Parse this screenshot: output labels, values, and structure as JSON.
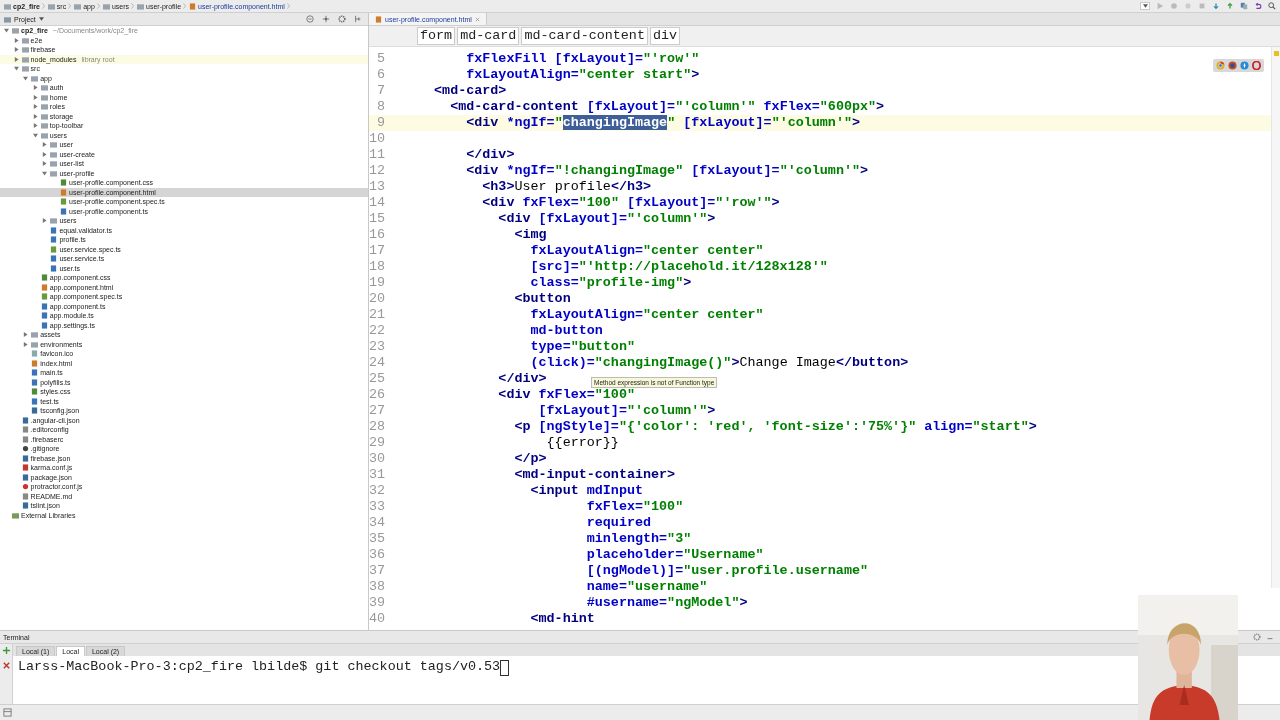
{
  "breadcrumbs": [
    {
      "label": "cp2_fire",
      "kind": "folder"
    },
    {
      "label": "src",
      "kind": "folder"
    },
    {
      "label": "app",
      "kind": "folder"
    },
    {
      "label": "users",
      "kind": "folder"
    },
    {
      "label": "user-profile",
      "kind": "folder"
    },
    {
      "label": "user-profile.component.html",
      "kind": "html"
    }
  ],
  "project_panel": {
    "title": "Project",
    "tree": [
      {
        "label": "cp2_fire",
        "path": "~/Documents/work/cp2_fire",
        "kind": "folder",
        "expanded": true,
        "selected": false,
        "children": [
          {
            "label": "e2e",
            "kind": "folder",
            "expanded": false,
            "selected": false
          },
          {
            "label": "firebase",
            "kind": "folder",
            "expanded": false,
            "selected": false
          },
          {
            "label": "node_modules",
            "hint": "library root",
            "kind": "folder",
            "expanded": false,
            "selected": false
          },
          {
            "label": "src",
            "kind": "folder",
            "expanded": true,
            "selected": false,
            "children": [
              {
                "label": "app",
                "kind": "folder",
                "expanded": true,
                "selected": false,
                "children": [
                  {
                    "label": "auth",
                    "kind": "folder",
                    "expanded": false,
                    "selected": false
                  },
                  {
                    "label": "home",
                    "kind": "folder",
                    "expanded": false,
                    "selected": false
                  },
                  {
                    "label": "roles",
                    "kind": "folder",
                    "expanded": false,
                    "selected": false
                  },
                  {
                    "label": "storage",
                    "kind": "folder",
                    "expanded": false,
                    "selected": false
                  },
                  {
                    "label": "top-toolbar",
                    "kind": "folder",
                    "expanded": false,
                    "selected": false
                  },
                  {
                    "label": "users",
                    "kind": "folder",
                    "expanded": true,
                    "selected": false,
                    "children": [
                      {
                        "label": "user",
                        "kind": "folder",
                        "expanded": false,
                        "selected": false
                      },
                      {
                        "label": "user-create",
                        "kind": "folder",
                        "expanded": false,
                        "selected": false
                      },
                      {
                        "label": "user-list",
                        "kind": "folder",
                        "expanded": false,
                        "selected": false
                      },
                      {
                        "label": "user-profile",
                        "kind": "folder",
                        "expanded": true,
                        "selected": false,
                        "children": [
                          {
                            "label": "user-profile.component.css",
                            "kind": "css",
                            "selected": false
                          },
                          {
                            "label": "user-profile.component.html",
                            "kind": "html",
                            "selected": true
                          },
                          {
                            "label": "user-profile.component.spec.ts",
                            "kind": "spec",
                            "selected": false
                          },
                          {
                            "label": "user-profile.component.ts",
                            "kind": "ts",
                            "selected": false
                          }
                        ]
                      },
                      {
                        "label": "users",
                        "kind": "folder",
                        "expanded": false,
                        "selected": false
                      },
                      {
                        "label": "equal.validator.ts",
                        "kind": "ts",
                        "selected": false
                      },
                      {
                        "label": "profile.ts",
                        "kind": "ts",
                        "selected": false
                      },
                      {
                        "label": "user.service.spec.ts",
                        "kind": "spec",
                        "selected": false
                      },
                      {
                        "label": "user.service.ts",
                        "kind": "ts",
                        "selected": false
                      },
                      {
                        "label": "user.ts",
                        "kind": "ts",
                        "selected": false
                      }
                    ]
                  },
                  {
                    "label": "app.component.css",
                    "kind": "css",
                    "selected": false
                  },
                  {
                    "label": "app.component.html",
                    "kind": "html",
                    "selected": false
                  },
                  {
                    "label": "app.component.spec.ts",
                    "kind": "spec",
                    "selected": false
                  },
                  {
                    "label": "app.component.ts",
                    "kind": "ts",
                    "selected": false
                  },
                  {
                    "label": "app.module.ts",
                    "kind": "ts",
                    "selected": false
                  },
                  {
                    "label": "app.settings.ts",
                    "kind": "ts",
                    "selected": false
                  }
                ]
              },
              {
                "label": "assets",
                "kind": "folder",
                "expanded": false,
                "selected": false
              },
              {
                "label": "environments",
                "kind": "folder",
                "expanded": false,
                "selected": false
              },
              {
                "label": "favicon.ico",
                "selected": false
              },
              {
                "label": "index.html",
                "kind": "html",
                "selected": false
              },
              {
                "label": "main.ts",
                "kind": "ts",
                "selected": false
              },
              {
                "label": "polyfills.ts",
                "kind": "ts",
                "selected": false
              },
              {
                "label": "styles.css",
                "kind": "css",
                "selected": false
              },
              {
                "label": "test.ts",
                "kind": "ts",
                "selected": false
              },
              {
                "label": "tsconfig.json",
                "kind": "json",
                "selected": false
              }
            ]
          },
          {
            "label": ".angular-cli.json",
            "kind": "json",
            "selected": false
          },
          {
            "label": ".editorconfig",
            "kind": "text",
            "selected": false
          },
          {
            "label": ".firebaserc",
            "kind": "text",
            "selected": false
          },
          {
            "label": ".gitignore",
            "kind": "git",
            "selected": false
          },
          {
            "label": "firebase.json",
            "kind": "json",
            "selected": false
          },
          {
            "label": "karma.conf.js",
            "kind": "karma",
            "selected": false
          },
          {
            "label": "package.json",
            "kind": "json",
            "selected": false
          },
          {
            "label": "protractor.conf.js",
            "kind": "protractor",
            "selected": false
          },
          {
            "label": "README.md",
            "kind": "text",
            "selected": false
          },
          {
            "label": "tslint.json",
            "kind": "json",
            "selected": false
          }
        ]
      },
      {
        "label": "External Libraries",
        "kind": "libraries",
        "selected": false
      }
    ]
  },
  "editor": {
    "tab": {
      "label": "user-profile.component.html",
      "selected": true
    },
    "breadcrumbs": [
      "form",
      "md-card",
      "md-card-content",
      "div"
    ],
    "lines": [
      {
        "num": "5",
        "current": false,
        "segments": [
          {
            "text": "      fxFlexFill [fxLayout]=\"'row'\"",
            "selected": false
          }
        ]
      },
      {
        "num": "6",
        "current": false,
        "segments": [
          {
            "text": "      fxLayoutAlign=\"center start\">",
            "selected": false
          }
        ]
      },
      {
        "num": "7",
        "current": false,
        "segments": [
          {
            "text": "  <md-card>",
            "selected": false
          }
        ]
      },
      {
        "num": "8",
        "current": false,
        "segments": [
          {
            "text": "    <md-card-content [fxLayout]=\"'column'\" fxFlex=\"600px\">",
            "selected": false
          }
        ]
      },
      {
        "num": "9",
        "current": true,
        "segments": [
          {
            "text": "      <div *ngIf=\"",
            "selected": false
          },
          {
            "text": "changingImage",
            "selected": true
          },
          {
            "text": "\" [fxLayout]=\"'column'\">",
            "selected": false
          }
        ]
      },
      {
        "num": "10",
        "current": false
      },
      {
        "num": "11",
        "current": false,
        "segments": [
          {
            "text": "      </div>",
            "selected": false
          }
        ]
      },
      {
        "num": "12",
        "current": false,
        "segments": [
          {
            "text": "      <div *ngIf=\"!changingImage\" [fxLayout]=\"'column'\">",
            "selected": false
          }
        ]
      },
      {
        "num": "13",
        "current": false,
        "segments": [
          {
            "text": "        <h3>User profile</h3>",
            "selected": false
          }
        ]
      },
      {
        "num": "14",
        "current": false,
        "segments": [
          {
            "text": "        <div fxFlex=\"100\" [fxLayout]=\"'row'\">",
            "selected": false
          }
        ]
      },
      {
        "num": "15",
        "current": false,
        "segments": [
          {
            "text": "          <div [fxLayout]=\"'column'\">",
            "selected": false
          }
        ]
      },
      {
        "num": "16",
        "current": false,
        "segments": [
          {
            "text": "            <img",
            "selected": false
          }
        ]
      },
      {
        "num": "17",
        "current": false,
        "segments": [
          {
            "text": "              fxLayoutAlign=\"center center\"",
            "selected": false
          }
        ]
      },
      {
        "num": "18",
        "current": false,
        "segments": [
          {
            "text": "              [src]=\"'http://placehold.it/128x128'\"",
            "selected": false
          }
        ]
      },
      {
        "num": "19",
        "current": false,
        "segments": [
          {
            "text": "              class=\"profile-img\">",
            "selected": false
          }
        ]
      },
      {
        "num": "20",
        "current": false,
        "segments": [
          {
            "text": "            <button",
            "selected": false
          }
        ]
      },
      {
        "num": "21",
        "current": false,
        "segments": [
          {
            "text": "              fxLayoutAlign=\"center center\"",
            "selected": false
          }
        ]
      },
      {
        "num": "22",
        "current": false,
        "segments": [
          {
            "text": "              md-button",
            "selected": false
          }
        ]
      },
      {
        "num": "23",
        "current": false,
        "segments": [
          {
            "text": "              type=\"button\"",
            "selected": false
          }
        ]
      },
      {
        "num": "24",
        "current": false,
        "segments": [
          {
            "text": "              (click)=\"changingImage()\">Change Image</button>",
            "selected": false
          }
        ],
        "tooltip": "Method expression is not of Function type"
      },
      {
        "num": "25",
        "current": false,
        "segments": [
          {
            "text": "          </div>",
            "selected": false
          }
        ]
      },
      {
        "num": "26",
        "current": false,
        "segments": [
          {
            "text": "          <div fxFlex=\"100\"",
            "selected": false
          }
        ]
      },
      {
        "num": "27",
        "current": false,
        "segments": [
          {
            "text": "               [fxLayout]=\"'column'\">",
            "selected": false
          }
        ]
      },
      {
        "num": "28",
        "current": false,
        "segments": [
          {
            "text": "            <p [ngStyle]=\"{'color': 'red', 'font-size':'75%'}\" align=\"start\">",
            "selected": false
          }
        ]
      },
      {
        "num": "29",
        "current": false,
        "segments": [
          {
            "text": "                {{error}}",
            "selected": false
          }
        ]
      },
      {
        "num": "30",
        "current": false,
        "segments": [
          {
            "text": "            </p>",
            "selected": false
          }
        ]
      },
      {
        "num": "31",
        "current": false,
        "segments": [
          {
            "text": "            <md-input-container>",
            "selected": false
          }
        ]
      },
      {
        "num": "32",
        "current": false,
        "segments": [
          {
            "text": "              <input mdInput",
            "selected": false
          }
        ]
      },
      {
        "num": "33",
        "current": false,
        "segments": [
          {
            "text": "                     fxFlex=\"100\"",
            "selected": false
          }
        ]
      },
      {
        "num": "34",
        "current": false,
        "segments": [
          {
            "text": "                     required",
            "selected": false
          }
        ]
      },
      {
        "num": "35",
        "current": false,
        "segments": [
          {
            "text": "                     minlength=\"3\"",
            "selected": false
          }
        ]
      },
      {
        "num": "36",
        "current": false,
        "segments": [
          {
            "text": "                     placeholder=\"Username\"",
            "selected": false
          }
        ]
      },
      {
        "num": "37",
        "current": false,
        "segments": [
          {
            "text": "                     [(ngModel)]=\"user.profile.username\"",
            "selected": false
          }
        ]
      },
      {
        "num": "38",
        "current": false,
        "segments": [
          {
            "text": "                     name=\"username\"",
            "selected": false
          }
        ]
      },
      {
        "num": "39",
        "current": false,
        "segments": [
          {
            "text": "                     #username=\"ngModel\">",
            "selected": false
          }
        ]
      },
      {
        "num": "40",
        "current": false,
        "segments": [
          {
            "text": "              <md-hint",
            "selected": false
          }
        ]
      }
    ]
  },
  "terminal": {
    "title": "Terminal",
    "tabs": [
      {
        "label": "Local (1)",
        "selected": false
      },
      {
        "label": "Local",
        "selected": true
      },
      {
        "label": "Local (2)",
        "selected": false
      }
    ],
    "command_line": "Larss-MacBook-Pro-3:cp2_fire lbilde$ git checkout tags/v0.53"
  }
}
